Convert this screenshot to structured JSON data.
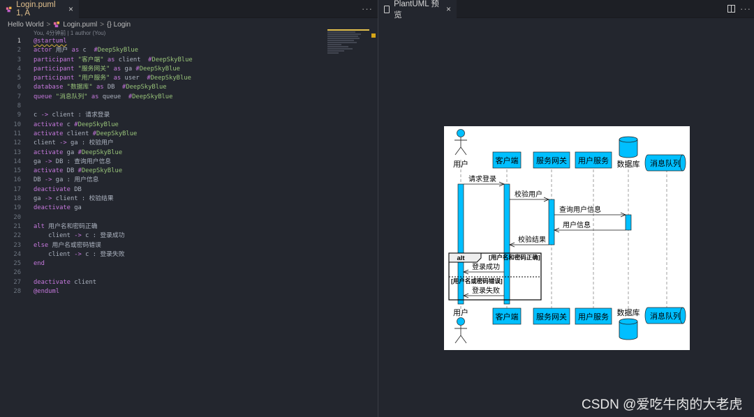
{
  "left_tab": {
    "title": "Login.puml 1, A"
  },
  "right_tab": {
    "title": "PlantUML 预览"
  },
  "more_label": "···",
  "close_label": "×",
  "breadcrumb": {
    "folder": "Hello World",
    "file": "Login.puml",
    "symbol": "{} Login"
  },
  "codelens": "You, 4分钟前 | 1 author (You)",
  "code_lines": [
    "@startuml",
    "actor 用户 as c  #DeepSkyBlue",
    "participant \"客户端\" as client  #DeepSkyBlue",
    "participant \"服务网关\" as ga #DeepSkyBlue",
    "participant \"用户服务\" as user  #DeepSkyBlue",
    "database \"数据库\" as DB  #DeepSkyBlue",
    "queue \"消息队列\" as queue  #DeepSkyBlue",
    "",
    "c -> client : 请求登录",
    "activate c #DeepSkyBlue",
    "activate client #DeepSkyBlue",
    "client -> ga : 校验用户",
    "activate ga #DeepSkyBlue",
    "ga -> DB : 查询用户信息",
    "activate DB #DeepSkyBlue",
    "DB -> ga : 用户信息",
    "deactivate DB",
    "ga -> client : 校验结果",
    "deactivate ga",
    "",
    "alt 用户名和密码正确",
    "    client -> c : 登录成功",
    "else 用户名或密码错误",
    "    client -> c : 登录失败",
    "end",
    "",
    "deactivate client",
    "@enduml"
  ],
  "diagram": {
    "participants": [
      "用户",
      "客户端",
      "服务网关",
      "用户服务",
      "数据库",
      "消息队列"
    ],
    "messages": [
      "请求登录",
      "校验用户",
      "查询用户信息",
      "用户信息",
      "校验结果",
      "登录成功",
      "登录失败"
    ],
    "alt_keyword": "alt",
    "alt_condition": "[用户名和密码正确]",
    "else_condition": "[用户名或密码错误]",
    "fill_color": "#00BFFF"
  },
  "watermark": "CSDN @爱吃牛肉的大老虎"
}
